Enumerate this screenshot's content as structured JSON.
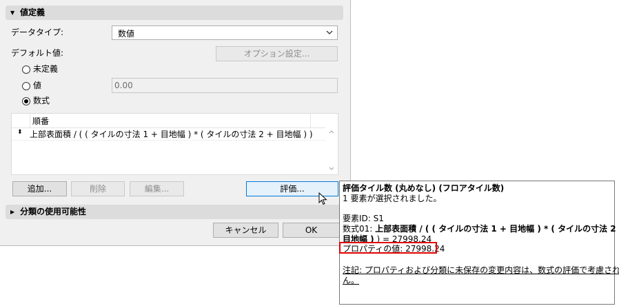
{
  "section_value_definition": {
    "title": "値定義"
  },
  "data_type": {
    "label": "データタイプ:",
    "selected": "数値"
  },
  "default_value": {
    "label": "デフォルト値:",
    "option_button": "オプション設定...",
    "radios": [
      {
        "label": "未定義",
        "checked": false
      },
      {
        "label": "値",
        "checked": false
      },
      {
        "label": "数式",
        "checked": true
      }
    ],
    "value_placeholder": "0.00"
  },
  "formula_list": {
    "header": "順番",
    "rows": [
      "上部表面積 / ( ( タイルの寸法 1 + 目地幅 ) * ( タイルの寸法 2 + 目地幅 ) )"
    ]
  },
  "buttons": {
    "add": "追加...",
    "delete": "削除",
    "edit": "編集...",
    "evaluate": "評価...",
    "cancel": "キャンセル",
    "ok": "OK"
  },
  "section_classification": {
    "title": "分類の使用可能性"
  },
  "tooltip": {
    "title": "評価タイル数 (丸めなし) (フロアタイル数)",
    "selected": "1 要素が選択されました。",
    "element_id": "要素ID: S1",
    "formula_prefix": "数式01: ",
    "formula_line1": "上部表面積 / ( ( タイルの寸法 1 + 目地幅 ) * ( タイルの寸法 2 +",
    "formula_line2": "目地幅 )",
    "formula_result": " ) = 27998.24",
    "property_value": "プロパティの値: 27998.24",
    "note_line1": "注記: プロパティおよび分類に未保存の変更内容は、数式の評価で考慮されませ",
    "note_line2": "ん。"
  },
  "colors": {
    "highlight_box": "#e00000",
    "focus_border": "#0078d7"
  }
}
